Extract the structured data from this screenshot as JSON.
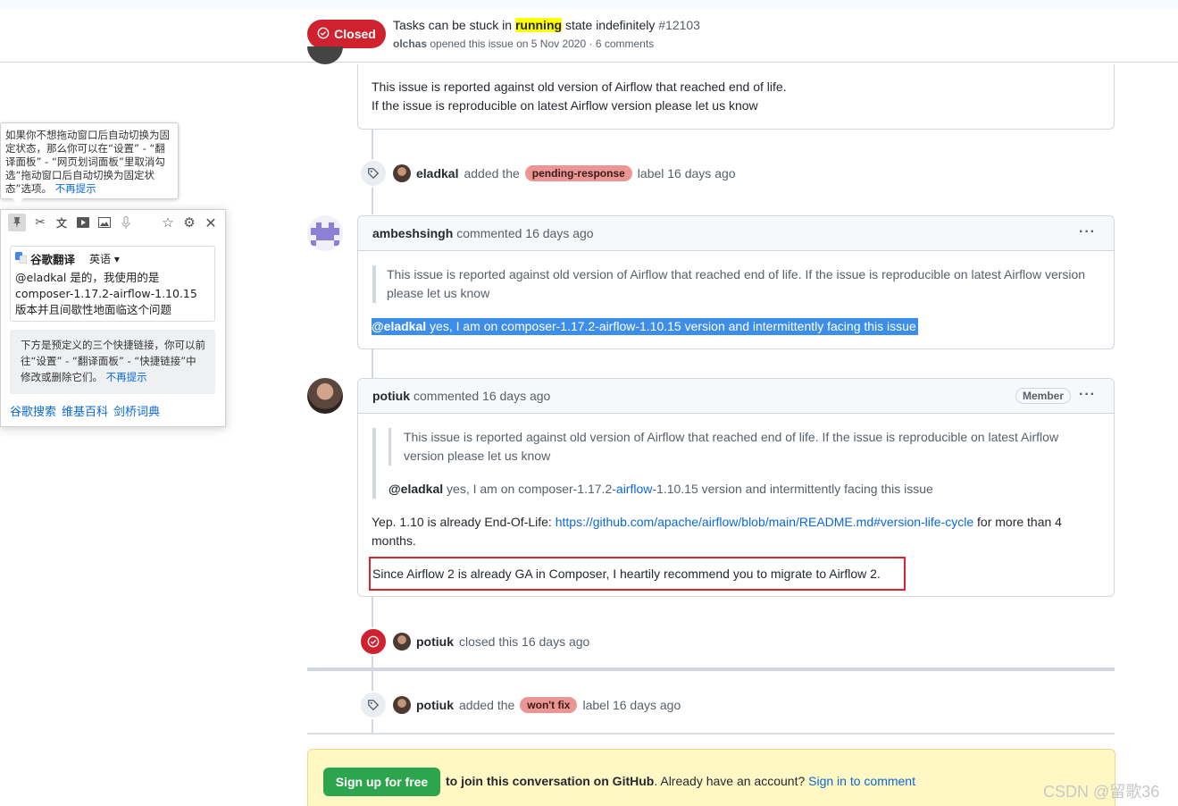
{
  "header": {
    "state_label": "Closed",
    "title_before": "Tasks can be stuck in ",
    "title_highlight": "running",
    "title_after": " state indefinitely",
    "number": "#12103",
    "author": "olchas",
    "meta_rest": "opened this issue on 5 Nov 2020 · 6 comments"
  },
  "first_comment": {
    "line1": "This issue is reported against old version of Airflow that reached end of life.",
    "line2": "If the issue is reproducible on latest Airflow version please let us know"
  },
  "event_label1": {
    "user": "eladkal",
    "action": "added the",
    "label": "pending-response",
    "label_color": "#e99695",
    "suffix": "label 16 days ago"
  },
  "comment_ambesh": {
    "user": "ambeshsingh",
    "meta": "commented 16 days ago",
    "quote": "This issue is reported against old version of Airflow that reached end of life. If the issue is reproducible on latest Airflow version please let us know",
    "mention": "@eladkal",
    "reply": " yes, I am on composer-1.17.2-airflow-1.10.15 version and intermittently facing this issue"
  },
  "comment_potiuk": {
    "user": "potiuk",
    "meta": "commented 16 days ago",
    "badge": "Member",
    "quote": "This issue is reported against old version of Airflow that reached end of life. If the issue is reproducible on latest Airflow version please let us know",
    "quote2_mention": "@eladkal",
    "quote2_before": " yes, I am on composer-1.17.2-",
    "quote2_link": "airflow",
    "quote2_after": "-1.10.15 version and intermittently facing this issue",
    "para1_before": "Yep. 1.10 is already End-Of-Life: ",
    "para1_link": "https://github.com/apache/airflow/blob/main/README.md#version-life-cycle",
    "para1_after": " for more than 4 months.",
    "para2": "Since Airflow 2 is already GA in Composer, I heartily recommend you to migrate to Airflow 2."
  },
  "event_closed": {
    "user": "potiuk",
    "text": "closed this 16 days ago"
  },
  "event_label2": {
    "user": "potiuk",
    "action": "added the",
    "label": "won't fix",
    "label_color": "#e99695",
    "suffix": "label 16 days ago"
  },
  "signup": {
    "button": "Sign up for free",
    "text_bold": "to join this conversation on GitHub",
    "text_rest": ". Already have an account? ",
    "signin": "Sign in to comment"
  },
  "translate_popup": {
    "tip_text": "如果你不想拖动窗口后自动切换为固定状态，那么你可以在“设置” - “翻译面板” - “网页划词面板”里取消勾选“拖动窗口后自动切换为固定状态”选项。",
    "tip_dismiss": "不再提示",
    "engine": "谷歌翻译",
    "language": "英语",
    "result": "@eladkal 是的，我使用的是 composer-1.17.2-airflow-1.10.15 版本并且间歇性地面临这个问题",
    "hint_text": "下方是预定义的三个快捷链接，你可以前往“设置” - “翻译面板” - “快捷链接”中修改或删除它们。",
    "hint_dismiss": "不再提示",
    "quick_links": [
      "谷歌搜索",
      "维基百科",
      "剑桥词典"
    ]
  },
  "watermark": "CSDN @留歌36"
}
